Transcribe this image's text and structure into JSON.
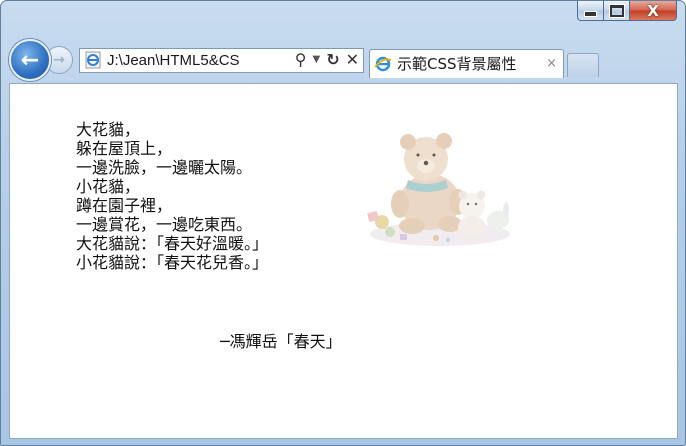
{
  "window": {
    "caption_buttons": {
      "minimize": "—",
      "maximize": "□",
      "close": "X"
    }
  },
  "navbar": {
    "back_icon": "back-arrow-icon",
    "forward_icon": "forward-arrow-icon",
    "address": "J:\\Jean\\HTML5&CS",
    "search_icon": "search-icon",
    "dropdown_icon": "chevron-down-icon",
    "refresh_icon": "refresh-icon",
    "stop_icon": "stop-icon"
  },
  "tab": {
    "title": "示範CSS背景屬性",
    "close": "×"
  },
  "content": {
    "poem_lines": [
      "大花貓，",
      "躲在屋頂上，",
      "一邊洗臉，一邊曬太陽。",
      "小花貓，",
      "蹲在園子裡，",
      "一邊賞花，一邊吃東西。",
      "大花貓說：「春天好溫暖。」",
      "小花貓說：「春天花兒香。」"
    ],
    "signature": "─馮輝岳「春天」",
    "background_image": "teddy-bear-with-toys"
  },
  "colors": {
    "frame": "#b7cfe8",
    "close_button": "#c23e24",
    "back_button": "#2f6fc0",
    "text": "#111111"
  }
}
